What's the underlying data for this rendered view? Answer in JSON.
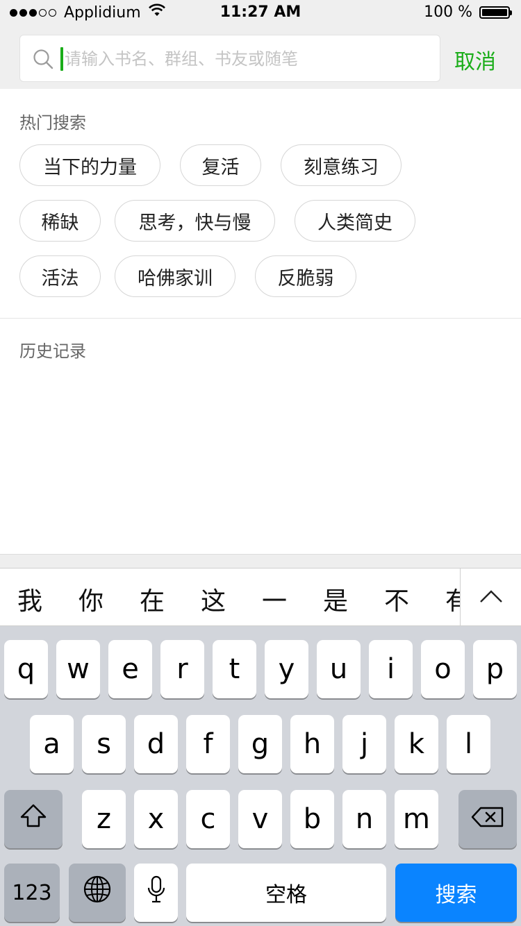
{
  "status_bar": {
    "carrier": "Applidium",
    "time": "11:27 AM",
    "battery": "100 %"
  },
  "search": {
    "placeholder": "请输入书名、群组、书友或随笔",
    "value": "",
    "cancel_label": "取消"
  },
  "hot_search": {
    "title": "热门搜索",
    "rows": [
      [
        "当下的力量",
        "复活",
        "刻意练习"
      ],
      [
        "稀缺",
        "思考，快与慢",
        "人类简史"
      ],
      [
        "活法",
        "哈佛家训",
        "反脆弱"
      ]
    ]
  },
  "history": {
    "title": "历史记录"
  },
  "keyboard": {
    "candidates": [
      "我",
      "你",
      "在",
      "这",
      "一",
      "是",
      "不",
      "有"
    ],
    "row1": [
      "q",
      "w",
      "e",
      "r",
      "t",
      "y",
      "u",
      "i",
      "o",
      "p"
    ],
    "row2": [
      "a",
      "s",
      "d",
      "f",
      "g",
      "h",
      "j",
      "k",
      "l"
    ],
    "row3": [
      "z",
      "x",
      "c",
      "v",
      "b",
      "n",
      "m"
    ],
    "numbers_label": "123",
    "space_label": "空格",
    "search_label": "搜索",
    "search_key_color": "#0a84ff",
    "accent_color": "#1aad19"
  }
}
